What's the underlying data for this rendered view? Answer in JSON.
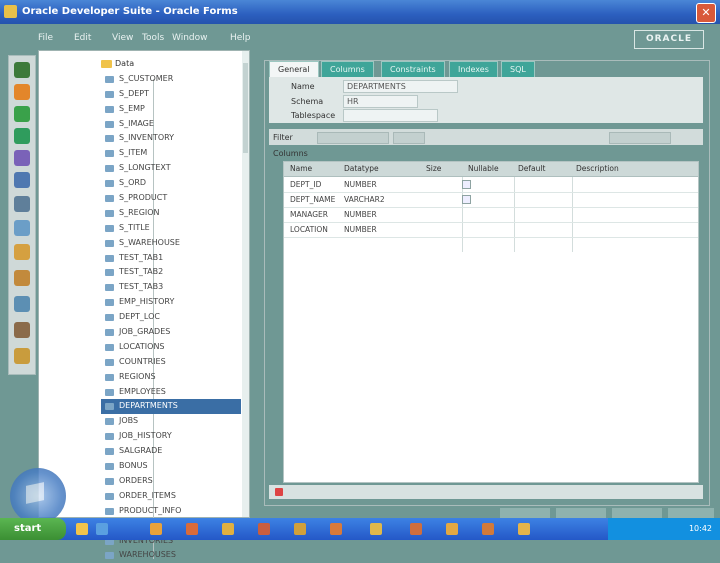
{
  "titlebar": {
    "title": "Oracle Developer Suite - Oracle Forms",
    "close": "✕"
  },
  "menu": [
    "File",
    "Edit",
    "View",
    "Tools",
    "Window",
    "Help"
  ],
  "brand": "ORACLE",
  "tree": {
    "root_label": "Data",
    "nodes": [
      "S_CUSTOMER",
      "S_DEPT",
      "S_EMP",
      "S_IMAGE",
      "S_INVENTORY",
      "S_ITEM",
      "S_LONGTEXT",
      "S_ORD",
      "S_PRODUCT",
      "S_REGION",
      "S_TITLE",
      "S_WAREHOUSE",
      "TEST_TAB1",
      "TEST_TAB2",
      "TEST_TAB3",
      "EMP_HISTORY",
      "DEPT_LOC",
      "JOB_GRADES",
      "LOCATIONS",
      "COUNTRIES",
      "REGIONS",
      "EMPLOYEES",
      "DEPARTMENTS",
      "JOBS",
      "JOB_HISTORY",
      "SALGRADE",
      "BONUS",
      "ORDERS",
      "ORDER_ITEMS",
      "PRODUCT_INFO",
      "CUSTOMERS",
      "INVENTORIES",
      "WAREHOUSES"
    ],
    "selected_index": 22
  },
  "form": {
    "tabs": [
      "General",
      "Columns",
      "Constraints",
      "Indexes",
      "SQL"
    ],
    "active_tab": 0,
    "fields": [
      {
        "label": "Name",
        "value": "DEPARTMENTS"
      },
      {
        "label": "Schema",
        "value": "HR"
      },
      {
        "label": "Tablespace",
        "value": ""
      }
    ],
    "filter_label": "Filter",
    "section_label": "Columns",
    "grid": {
      "headers": [
        "Name",
        "Datatype",
        "Size",
        "Nullable",
        "Default",
        "Description"
      ],
      "rows": [
        [
          "DEPT_ID",
          "NUMBER",
          "",
          "",
          "",
          ""
        ],
        [
          "DEPT_NAME",
          "VARCHAR2",
          "",
          "",
          "",
          ""
        ],
        [
          "MANAGER",
          "NUMBER",
          "",
          "",
          "",
          ""
        ],
        [
          "LOCATION",
          "NUMBER",
          "",
          "",
          "",
          ""
        ]
      ]
    }
  },
  "taskbar": {
    "start": "start",
    "clock": "10:42"
  },
  "colors": {
    "teal_bg": "#6f9894",
    "tab_teal": "#3fa599",
    "selection": "#3a6ea5"
  }
}
